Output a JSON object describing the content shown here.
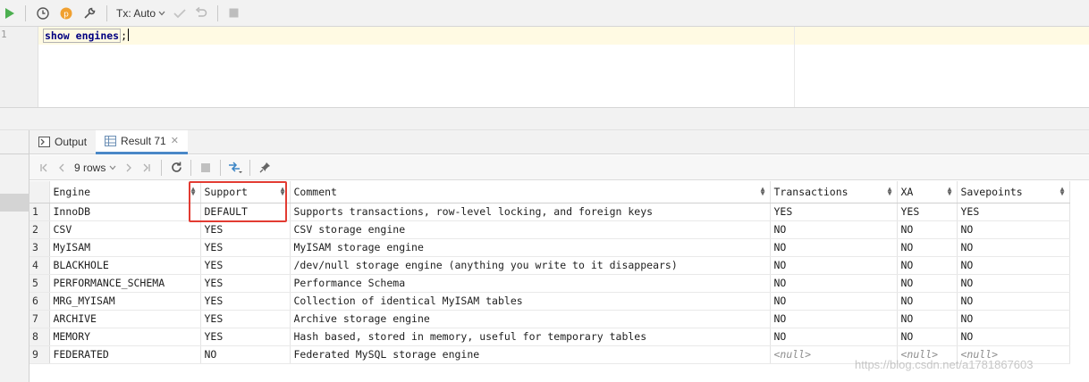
{
  "toolbar": {
    "tx_label": "Tx: Auto"
  },
  "editor": {
    "line_number": "1",
    "keyword1": "show",
    "keyword2": "engines",
    "terminator": ";"
  },
  "tabs": [
    {
      "label": "Output"
    },
    {
      "label": "Result 71"
    }
  ],
  "result_toolbar": {
    "rows_label": "9 rows"
  },
  "grid": {
    "columns": [
      "Engine",
      "Support",
      "Comment",
      "Transactions",
      "XA",
      "Savepoints"
    ],
    "rows": [
      {
        "n": "1",
        "engine": "InnoDB",
        "support": "DEFAULT",
        "comment": "Supports transactions, row-level locking, and foreign keys",
        "transactions": "YES",
        "xa": "YES",
        "savepoints": "YES"
      },
      {
        "n": "2",
        "engine": "CSV",
        "support": "YES",
        "comment": "CSV storage engine",
        "transactions": "NO",
        "xa": "NO",
        "savepoints": "NO"
      },
      {
        "n": "3",
        "engine": "MyISAM",
        "support": "YES",
        "comment": "MyISAM storage engine",
        "transactions": "NO",
        "xa": "NO",
        "savepoints": "NO"
      },
      {
        "n": "4",
        "engine": "BLACKHOLE",
        "support": "YES",
        "comment": "/dev/null storage engine (anything you write to it disappears)",
        "transactions": "NO",
        "xa": "NO",
        "savepoints": "NO"
      },
      {
        "n": "5",
        "engine": "PERFORMANCE_SCHEMA",
        "support": "YES",
        "comment": "Performance Schema",
        "transactions": "NO",
        "xa": "NO",
        "savepoints": "NO"
      },
      {
        "n": "6",
        "engine": "MRG_MYISAM",
        "support": "YES",
        "comment": "Collection of identical MyISAM tables",
        "transactions": "NO",
        "xa": "NO",
        "savepoints": "NO"
      },
      {
        "n": "7",
        "engine": "ARCHIVE",
        "support": "YES",
        "comment": "Archive storage engine",
        "transactions": "NO",
        "xa": "NO",
        "savepoints": "NO"
      },
      {
        "n": "8",
        "engine": "MEMORY",
        "support": "YES",
        "comment": "Hash based, stored in memory, useful for temporary tables",
        "transactions": "NO",
        "xa": "NO",
        "savepoints": "NO"
      },
      {
        "n": "9",
        "engine": "FEDERATED",
        "support": "NO",
        "comment": "Federated MySQL storage engine",
        "transactions": "<null>",
        "xa": "<null>",
        "savepoints": "<null>"
      }
    ]
  },
  "watermark": "https://blog.csdn.net/a1781867603",
  "colors": {
    "highlight_box": "#e23b32",
    "run_icon": "#4caf50",
    "active_tab_underline": "#4a88c7",
    "null_value": "#8c8c8c"
  }
}
